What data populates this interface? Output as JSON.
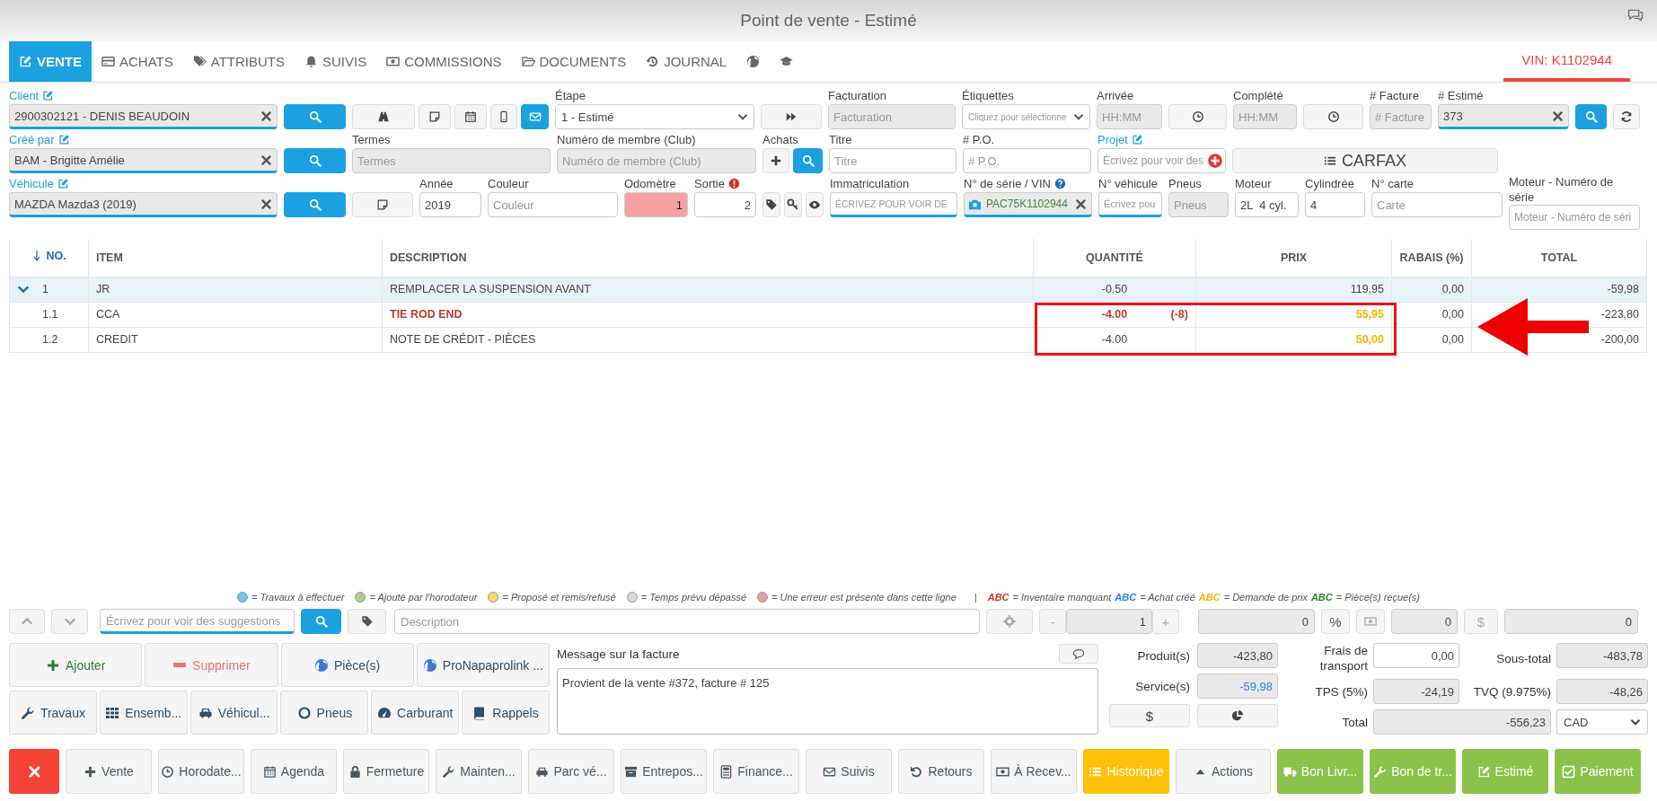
{
  "window": {
    "title": "Point de vente - Estimé"
  },
  "tabs": [
    {
      "label": "VENTE",
      "selected": true
    },
    {
      "label": "ACHATS",
      "selected": false
    },
    {
      "label": "ATTRIBUTS",
      "selected": false
    },
    {
      "label": "SUIVIS",
      "selected": false
    },
    {
      "label": "COMMISSIONS",
      "selected": false
    },
    {
      "label": "DOCUMENTS",
      "selected": false
    },
    {
      "label": "JOURNAL",
      "selected": false
    },
    {
      "selected": false
    },
    {
      "selected": false
    }
  ],
  "vin_tab": {
    "label": "VIN: K1102944"
  },
  "form_rows": [
    [
      {
        "label": "Client",
        "link": true,
        "controls": [
          {
            "kind": "input",
            "value": "2900302121 - DENIS BEAUDOIN",
            "disabled": true,
            "underlined": true,
            "clearable": true
          }
        ]
      },
      {
        "controls": [
          {
            "kind": "search",
            "primary": true
          }
        ]
      },
      {
        "controls": [
          {
            "kind": "road",
            "primary": false
          },
          {
            "kind": "note",
            "primary": false
          },
          {
            "kind": "calendar",
            "primary": false
          },
          {
            "kind": "mobile",
            "primary": false
          },
          {
            "kind": "mail",
            "primary": true
          }
        ]
      },
      {
        "label": "Étape",
        "controls": [
          {
            "kind": "select",
            "value": "1 - Estimé"
          }
        ]
      },
      {
        "controls": [
          {
            "kind": "forward",
            "primary": false
          }
        ]
      },
      {
        "label": "Facturation",
        "controls": [
          {
            "kind": "input",
            "placeholder": "Facturation",
            "disabled": true
          }
        ]
      },
      {
        "label": "Étiquettes",
        "controls": [
          {
            "kind": "select",
            "placeholder": "Cliquez pour sélectionne"
          }
        ]
      },
      {
        "label": "Arrivée",
        "controls": [
          {
            "kind": "input",
            "placeholder": "HH:MM",
            "disabled": true
          }
        ]
      },
      {
        "controls": [
          {
            "kind": "clock",
            "primary": false
          }
        ]
      },
      {
        "label": "Complété",
        "controls": [
          {
            "kind": "input",
            "placeholder": "HH:MM",
            "disabled": true
          }
        ]
      },
      {
        "controls": [
          {
            "kind": "clock",
            "primary": false
          }
        ]
      },
      {
        "label": "# Facture",
        "controls": [
          {
            "kind": "input",
            "placeholder": "# Facture",
            "disabled": true
          }
        ]
      },
      {
        "label": "# Estimé",
        "controls": [
          {
            "kind": "input",
            "value": "373",
            "disabled": true,
            "underlined": true,
            "clearable": true
          }
        ]
      },
      {
        "controls": [
          {
            "kind": "search",
            "primary": true
          }
        ]
      },
      {
        "controls": [
          {
            "kind": "refresh",
            "primary": false
          }
        ]
      }
    ],
    [
      {
        "label": "Créé par",
        "link": true,
        "controls": [
          {
            "kind": "input",
            "value": "BAM - Brigitte Amélie",
            "disabled": true,
            "underlined": true,
            "clearable": true
          }
        ]
      },
      {
        "controls": [
          {
            "kind": "search",
            "primary": true
          }
        ]
      },
      {
        "label": "Termes",
        "controls": [
          {
            "kind": "input",
            "placeholder": "Termes",
            "disabled": true
          }
        ]
      },
      {
        "label": "Numéro de membre (Club)",
        "controls": [
          {
            "kind": "input",
            "placeholder": "Numéro de membre (Club)",
            "disabled": true
          }
        ]
      },
      {
        "label": "Achats",
        "controls": [
          {
            "kind": "plus",
            "primary": false
          },
          {
            "kind": "search",
            "primary": true
          }
        ]
      },
      {
        "label": "Titre",
        "controls": [
          {
            "kind": "input",
            "placeholder": "Titre"
          }
        ]
      },
      {
        "label": "# P.O.",
        "controls": [
          {
            "kind": "input",
            "placeholder": "# P.O."
          }
        ]
      },
      {
        "label": "Projet",
        "link": true,
        "controls": [
          {
            "kind": "input",
            "placeholder": "Écrivez pour voir des",
            "badge": true
          }
        ]
      },
      {
        "controls": [
          {
            "kind": "carfax",
            "text": "CARFAX",
            "primary": false
          }
        ]
      }
    ],
    [
      {
        "label": "Véhicule",
        "link": true,
        "controls": [
          {
            "kind": "input",
            "value": "MAZDA Mazda3 (2019)",
            "disabled": true,
            "underlined": true,
            "clearable": true
          }
        ]
      },
      {
        "controls": [
          {
            "kind": "search",
            "primary": true
          }
        ]
      },
      {
        "controls": [
          {
            "kind": "note",
            "primary": false
          }
        ]
      },
      {
        "label": "Année",
        "controls": [
          {
            "kind": "input",
            "value": "2019"
          }
        ]
      },
      {
        "label": "Couleur",
        "controls": [
          {
            "kind": "input",
            "placeholder": "Couleur"
          }
        ]
      },
      {
        "label": "Odomètre",
        "controls": [
          {
            "kind": "number",
            "value": "1",
            "error": true
          }
        ]
      },
      {
        "label": "Sortie",
        "alert": true,
        "controls": [
          {
            "kind": "number",
            "value": "2"
          }
        ]
      },
      {
        "controls": [
          {
            "kind": "tag",
            "primary": false
          },
          {
            "kind": "key",
            "primary": false
          },
          {
            "kind": "eye",
            "primary": false
          }
        ]
      },
      {
        "label": "Immatriculation",
        "controls": [
          {
            "kind": "input",
            "placeholder": "ÉCRIVEZ POUR VOIR DE",
            "underlined": true
          }
        ]
      },
      {
        "label": "N° de série / VIN",
        "help": true,
        "controls": [
          {
            "kind": "input",
            "value": "PAC75K1102944",
            "camera": true,
            "verified": true,
            "disabled": true,
            "underlined": true,
            "clearable": true
          }
        ]
      },
      {
        "label": "N° véhicule",
        "controls": [
          {
            "kind": "input",
            "placeholder": "Écrivez pou",
            "underlined": true
          }
        ]
      },
      {
        "label": "Pneus",
        "controls": [
          {
            "kind": "input",
            "placeholder": "Pneus",
            "disabled": true
          }
        ]
      },
      {
        "label": "Moteur",
        "controls": [
          {
            "kind": "input",
            "value": "2L  4 cyl."
          }
        ]
      },
      {
        "label": "Cylindrée",
        "controls": [
          {
            "kind": "input",
            "value": "4"
          }
        ]
      },
      {
        "label": "N° carte",
        "controls": [
          {
            "kind": "input",
            "placeholder": "Carte"
          }
        ]
      },
      {
        "label": "Moteur - Numéro de série",
        "controls": [
          {
            "kind": "input",
            "placeholder": "Moteur - Numéro de séri"
          }
        ]
      }
    ]
  ],
  "table": {
    "columns": [
      {
        "label": "NO.",
        "sorted": true
      },
      {
        "label": "ITEM",
        "sorted": false
      },
      {
        "label": "DESCRIPTION",
        "sorted": false
      },
      {
        "label": "QUANTITÉ",
        "sorted": false
      },
      {
        "label": "PRIX",
        "sorted": false
      },
      {
        "label": "RABAIS (%)",
        "sorted": false
      },
      {
        "label": "TOTAL",
        "sorted": false
      }
    ],
    "rows": [
      {
        "no": "1",
        "item": "JR",
        "description": "REMPLACER LA SUSPENSION AVANT",
        "quantity": "-0.50",
        "price": "119,95",
        "discount": "0,00",
        "total": "-59,98",
        "highlighted": true,
        "expanded": true,
        "children": [
          {
            "no": "1.1",
            "item": "CCA",
            "description": "TIE ROD END",
            "quantity": "-4.00",
            "quantity_note": "(-8)",
            "price": "55,95",
            "discount": "0,00",
            "total": "-223,80",
            "highlighted": false,
            "missing": true,
            "price_requested": true
          },
          {
            "no": "1.2",
            "item": "CREDIT",
            "description": "NOTE DE CRÉDIT - PIÈCES",
            "quantity": "-4.00",
            "price": "50,00",
            "discount": "0,00",
            "total": "-200,00",
            "highlighted": false,
            "missing": false,
            "price_requested": true
          }
        ]
      }
    ]
  },
  "markup": {
    "highlight_frame": true,
    "pointer_arrow": true
  },
  "legend": [
    {
      "color": "#6ec6f0",
      "text": "= Travaux à effectuer"
    },
    {
      "color": "#a8d08d",
      "text": "= Ajouté par l'horodateur"
    },
    {
      "color": "#f7d96b",
      "text": "= Proposé et remis/refusé"
    },
    {
      "color": "#d9d9d9",
      "text": "= Temps prévu dépassé"
    },
    {
      "color": "#f29b9b",
      "text": "= Une erreur est présente dans cette ligne"
    }
  ],
  "legend_separator": "|",
  "text_legend": [
    {
      "sample": "ABC",
      "color": "#c0392b",
      "text": "= Inventaire manquant"
    },
    {
      "sample": "ABC",
      "color": "#1e88e5",
      "text": "= Achat créé"
    },
    {
      "sample": "ABC",
      "color": "#f4b400",
      "text": "= Demande de prix"
    },
    {
      "sample": "ABC",
      "color": "#2e7d32",
      "text": "= Pièce(s) reçue(s)"
    }
  ],
  "item_bar": {
    "suggestion_placeholder": "Écrivez pour voir des suggestions",
    "description_placeholder": "Description",
    "minus": "-",
    "quantity": "1",
    "plus": "+",
    "field_1": "0",
    "percent": "%",
    "field_2": "0",
    "dollar": "$",
    "field_3": "0"
  },
  "actions": [
    [
      {
        "label": "Ajouter",
        "kind": "add"
      },
      {
        "label": "Supprimer",
        "kind": "delete"
      },
      {
        "label": "Pièce(s)",
        "kind": "default"
      },
      {
        "label": "ProNapaprolink ...",
        "kind": "default"
      }
    ],
    [
      {
        "label": "Travaux",
        "kind": "default"
      },
      {
        "label": "Ensemb...",
        "kind": "default"
      },
      {
        "label": "Véhicul...",
        "kind": "default"
      },
      {
        "label": "Pneus",
        "kind": "default"
      },
      {
        "label": "Carburant",
        "kind": "default"
      },
      {
        "label": "Rappels",
        "kind": "default"
      }
    ]
  ],
  "message": {
    "label": "Message sur la facture",
    "value": "Provient de la vente #372, facture # 125"
  },
  "summary": [
    {
      "label": "Produit(s)",
      "value": "-423,80",
      "accent": false
    },
    {
      "label": "Service(s)",
      "value": "-59,98",
      "accent": true
    }
  ],
  "summary_buttons": [
    {
      "kind": "text",
      "label": "$"
    },
    {
      "kind": "chart"
    }
  ],
  "totals": {
    "transport": {
      "label": "Frais de transport",
      "value": "0,00"
    },
    "subtotal": {
      "label": "Sous-total",
      "value": "-483,78"
    },
    "tps": {
      "label": "TPS (5%)",
      "value": "-24,19"
    },
    "tvq": {
      "label": "TVQ (9.975%)",
      "value": "-48,26"
    },
    "total": {
      "label": "Total",
      "value": "-556,23"
    },
    "currency": "CAD"
  },
  "bottom_buttons": [
    {
      "kind": "danger"
    },
    {
      "label": "Vente",
      "kind": "default"
    },
    {
      "label": "Horodate...",
      "kind": "default"
    },
    {
      "label": "Agenda",
      "kind": "default"
    },
    {
      "label": "Fermeture",
      "kind": "default"
    },
    {
      "label": "Mainten...",
      "kind": "default"
    },
    {
      "label": "Parc vé...",
      "kind": "default"
    },
    {
      "label": "Entrepos...",
      "kind": "default"
    },
    {
      "label": "Finance...",
      "kind": "default"
    },
    {
      "label": "Suivis",
      "kind": "default"
    },
    {
      "label": "Retours",
      "kind": "default"
    },
    {
      "label": "À Recev...",
      "kind": "default"
    },
    {
      "label": "Historique",
      "kind": "warning"
    },
    {
      "label": "Actions",
      "kind": "default"
    },
    {
      "label": "Bon Livr...",
      "kind": "success"
    },
    {
      "label": "Bon de tr...",
      "kind": "success"
    },
    {
      "label": "Estimé",
      "kind": "success"
    },
    {
      "label": "Paiement",
      "kind": "success"
    }
  ]
}
